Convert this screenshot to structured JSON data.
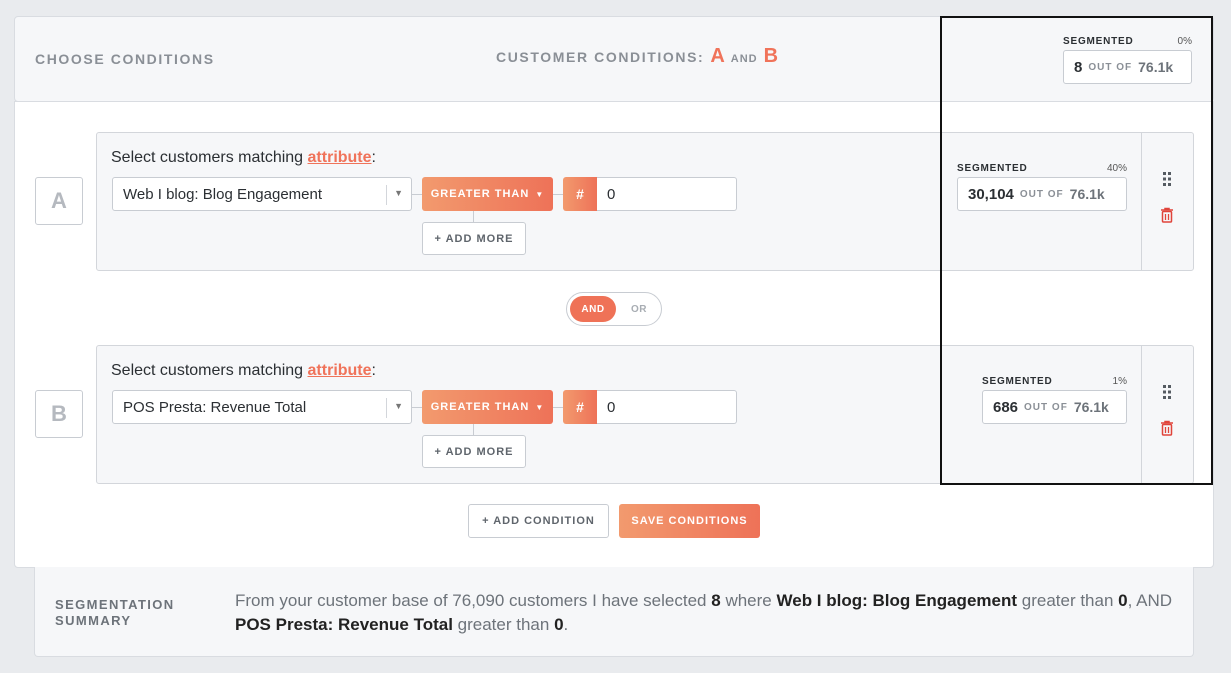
{
  "header": {
    "choose_title": "CHOOSE CONDITIONS",
    "customer_conditions_label": "CUSTOMER CONDITIONS:",
    "cond_a": "A",
    "and_word": "AND",
    "cond_b": "B",
    "segmented": {
      "label": "SEGMENTED",
      "pct": "0%",
      "count": "8",
      "out_of": "OUT OF",
      "total": "76.1k"
    }
  },
  "conditions": [
    {
      "letter": "A",
      "title_prefix": "Select customers matching",
      "title_link": "attribute",
      "title_suffix": ":",
      "attribute": "Web I blog: Blog Engagement",
      "operator": "GREATER THAN",
      "hash": "#",
      "value": "0",
      "add_more": "+ ADD MORE",
      "segmented": {
        "label": "SEGMENTED",
        "pct": "40%",
        "count": "30,104",
        "out_of": "OUT OF",
        "total": "76.1k"
      }
    },
    {
      "letter": "B",
      "title_prefix": "Select customers matching",
      "title_link": "attribute",
      "title_suffix": ":",
      "attribute": "POS Presta: Revenue Total",
      "operator": "GREATER THAN",
      "hash": "#",
      "value": "0",
      "add_more": "+ ADD MORE",
      "segmented": {
        "label": "SEGMENTED",
        "pct": "1%",
        "count": "686",
        "out_of": "OUT OF",
        "total": "76.1k"
      }
    }
  ],
  "toggle": {
    "and": "AND",
    "or": "OR",
    "selected": "AND"
  },
  "actions": {
    "add_condition": "+ ADD CONDITION",
    "save_conditions": "SAVE CONDITIONS"
  },
  "summary": {
    "label_line1": "SEGMENTATION",
    "label_line2": "SUMMARY",
    "t1": "From your customer base of 76,090 customers I have selected",
    "b1": "8",
    "t2": "where",
    "b2": "Web I blog: Blog Engagement",
    "t3": "greater than",
    "b3": "0",
    "t4": ", AND",
    "b4": "POS Presta: Revenue Total",
    "t5": "greater than",
    "b5": "0",
    "t6": "."
  },
  "colors": {
    "accent": "#f0735a",
    "accent_light": "#f29a6e",
    "trash": "#e0443b",
    "drag": "#555b62"
  },
  "icons": {
    "drag": "drag-handle-icon",
    "trash": "trash-icon",
    "caret": "caret-down-icon"
  }
}
